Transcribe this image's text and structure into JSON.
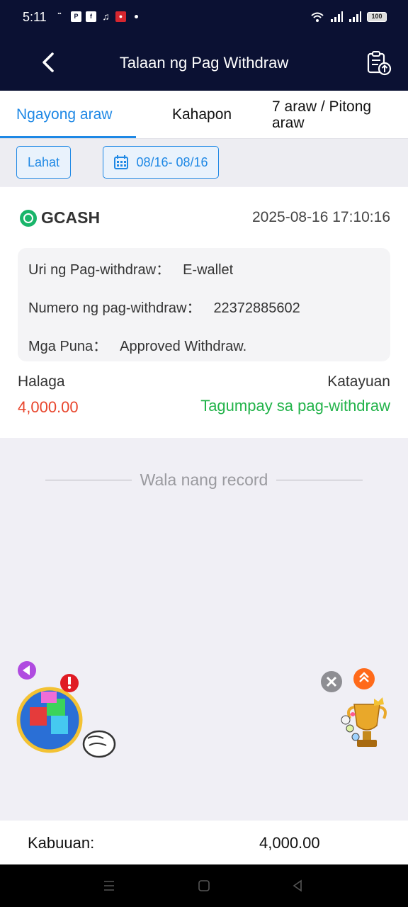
{
  "status_bar": {
    "time": "5:11",
    "battery": "100"
  },
  "header": {
    "title": "Talaan ng Pag Withdraw"
  },
  "tabs": [
    {
      "label": "Ngayong araw",
      "active": true
    },
    {
      "label": "Kahapon",
      "active": false
    },
    {
      "label": "7 araw / Pitong araw",
      "active": false
    }
  ],
  "filters": {
    "all_label": "Lahat",
    "date_range": "08/16- 08/16"
  },
  "record": {
    "brand": "GCASH",
    "datetime": "2025-08-16 17:10:16",
    "type_label": "Uri ng Pag-withdraw：",
    "type_value": "E-wallet",
    "number_label": "Numero ng pag-withdraw：",
    "number_value": "22372885602",
    "remarks_label": "Mga Puna：",
    "remarks_value": "Approved Withdraw.",
    "amount_label": "Halaga",
    "amount_value": "4,000.00",
    "status_label": "Katayuan",
    "status_value": "Tagumpay sa pag-withdraw"
  },
  "no_more_records": "Wala nang record",
  "footer": {
    "total_label": "Kabuuan:",
    "total_value": "4,000.00"
  },
  "colors": {
    "header_bg": "#0b1133",
    "accent": "#1e88e5",
    "amount": "#e8452c",
    "success": "#22b34a"
  }
}
